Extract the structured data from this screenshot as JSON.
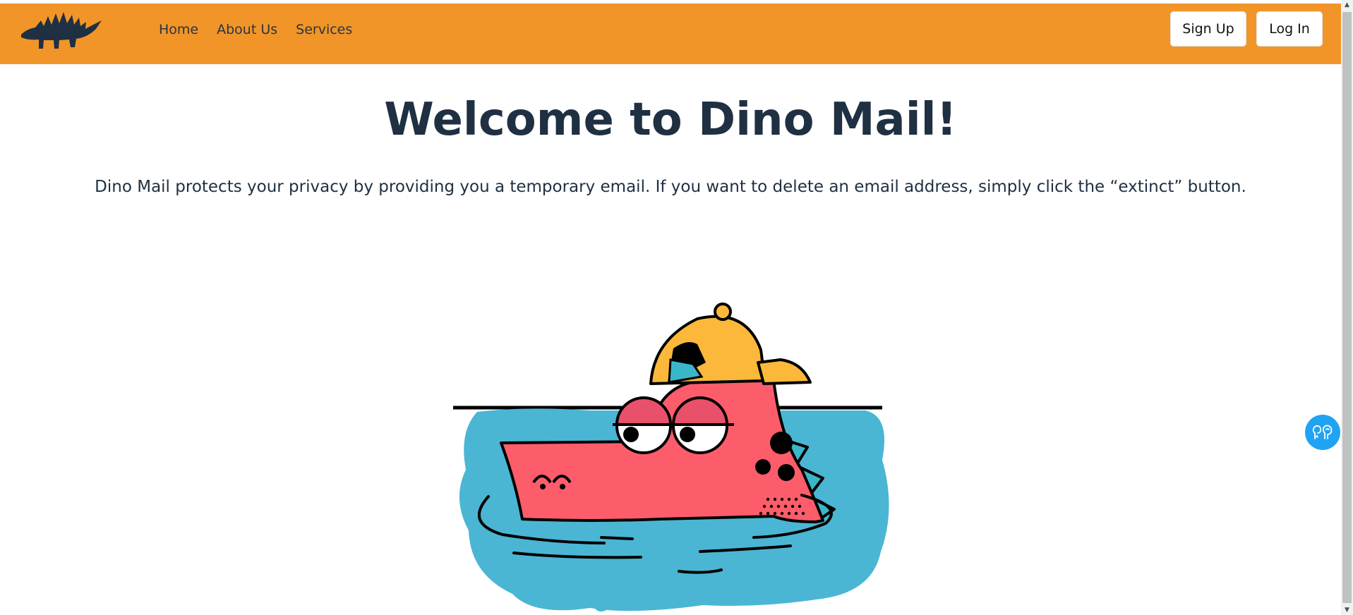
{
  "navbar": {
    "logo_icon": "stegosaurus-logo-icon",
    "links": [
      "Home",
      "About Us",
      "Services"
    ],
    "signup_label": "Sign Up",
    "login_label": "Log In",
    "bg_color": "#f19528"
  },
  "hero": {
    "title": "Welcome to Dino Mail!",
    "description": "Dino Mail protects your privacy by providing you a temporary email. If you want to delete an email address, simply click the “extinct” button.",
    "illustration": "dinosaur-in-water-illustration"
  },
  "help_button": {
    "icon": "accessibility-help-icon",
    "color": "#1fa3f2"
  }
}
